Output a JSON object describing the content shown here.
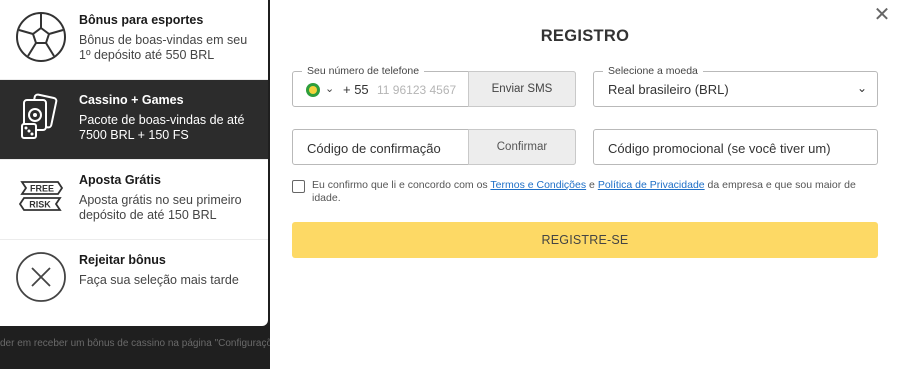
{
  "backdrop": {
    "hint_text": "der em receber um bônus de cassino na página \"Configurações\""
  },
  "bonuses": [
    {
      "icon": "soccer-ball-icon",
      "title": "Bônus para esportes",
      "description": "Bônus de boas-vindas em seu 1º depósito até 550 BRL",
      "active": false
    },
    {
      "icon": "casino-cards-dice-icon",
      "title": "Cassino + Games",
      "description": "Pacote de boas-vindas de até 7500 BRL + 150 FS",
      "active": true
    },
    {
      "icon": "free-risk-ticket-icon",
      "title": "Aposta Grátis",
      "description": "Aposta grátis no seu primeiro depósito de até 150 BRL",
      "active": false
    },
    {
      "icon": "reject-x-circle-icon",
      "title": "Rejeitar bônus",
      "description": "Faça sua seleção mais tarde",
      "active": false
    }
  ],
  "ticket_text": {
    "free": "FREE",
    "risk": "RISK"
  },
  "modal": {
    "title": "REGISTRO",
    "close_icon": "close-icon",
    "phone": {
      "legend": "Seu número de telefone",
      "flag_icon": "brazil-flag-icon",
      "prefix": "+ 55",
      "placeholder": "11 96123 4567",
      "sms_button": "Enviar SMS"
    },
    "currency": {
      "legend": "Selecione a moeda",
      "value": "Real brasileiro (BRL)"
    },
    "confirmation": {
      "placeholder": "Código de confirmação",
      "button": "Confirmar"
    },
    "promo": {
      "placeholder": "Código promocional (se você tiver um)"
    },
    "terms": {
      "prefix": "Eu confirmo que li e concordo com os",
      "terms_link": "Termos e Condições",
      "and": "e",
      "privacy_link": "Política de Privacidade",
      "suffix": "da empresa e que sou maior de idade."
    },
    "register_button": "REGISTRE-SE"
  },
  "colors": {
    "accent_yellow": "#fdd965",
    "active_bg": "#2c2c2c",
    "link_blue": "#1e6fc7",
    "brazil_green": "#2e9e3c",
    "brazil_yellow": "#f4d33b"
  }
}
